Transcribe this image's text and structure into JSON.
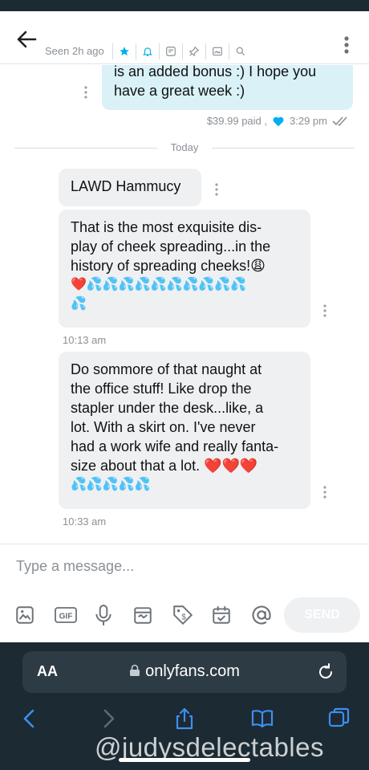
{
  "header": {
    "seen_text": "Seen 2h ago",
    "icons": [
      "star-icon",
      "bell-icon",
      "note-icon",
      "pin-icon",
      "image-icon",
      "search-icon"
    ]
  },
  "messages": {
    "outgoing": {
      "line1": "is an added bonus :) I hope you",
      "line2": "have a great week :)",
      "price": "$39.99 paid ,",
      "time": "3:29 pm"
    },
    "divider_label": "Today",
    "incoming": [
      {
        "lines": [
          "LAWD Hammucy"
        ]
      },
      {
        "lines": [
          "That is the most exquisite dis-",
          "play of cheek spreading...in the",
          "history of spreading cheeks!😩"
        ],
        "emoji_line1": "❤️💦💦💦💦💦💦💦💦💦💦",
        "emoji_line2": "💦",
        "time": "10:13 am"
      },
      {
        "lines": [
          "Do sommore of that naught at",
          "the office stuff! Like drop the",
          "stapler under the desk...like, a",
          "lot. With a skirt on. I've never",
          "had a work wife and really fanta-",
          "size about that a lot. ❤️❤️❤️"
        ],
        "emoji_line1": "💦💦💦💦💦",
        "time": "10:33 am"
      }
    ]
  },
  "composer": {
    "placeholder": "Type a message...",
    "send_label": "SEND",
    "tools": [
      "image-icon",
      "gif-icon",
      "microphone-icon",
      "vault-icon",
      "price-tag-icon",
      "calendar-icon",
      "at-icon"
    ],
    "gif_label": "GIF"
  },
  "browser": {
    "aa_label": "AA",
    "domain": "onlyfans.com"
  },
  "watermark": "@judysdelectables",
  "colors": {
    "accent": "#00aff0",
    "heart": "#e0202a",
    "drop": "#2c8fd6",
    "browser_bg": "#1c2a33"
  }
}
